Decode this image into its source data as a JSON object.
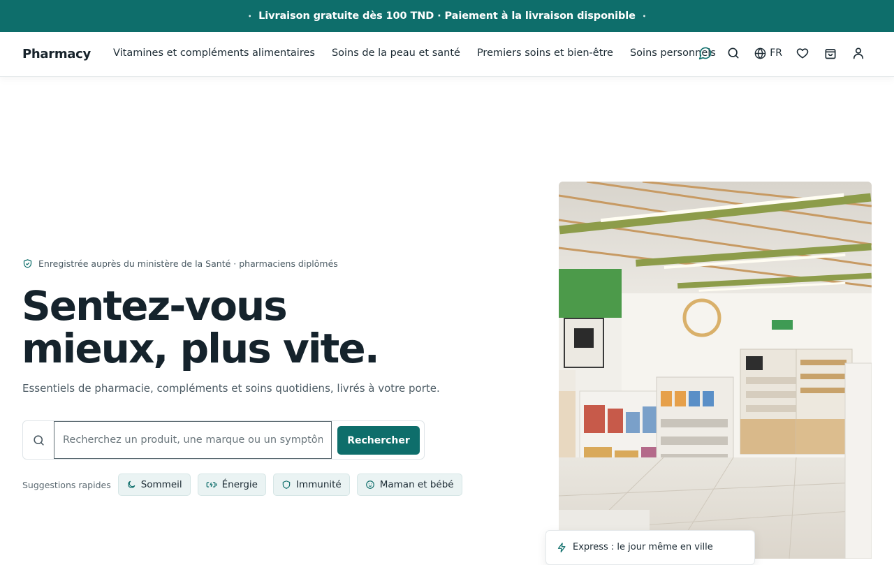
{
  "announcement": {
    "text": "Livraison gratuite dès 100 TND · Paiement à la livraison disponible",
    "bullet": "•"
  },
  "header": {
    "logo": "Pharmacy",
    "nav": [
      {
        "label": "Vitamines et compléments alimentaires"
      },
      {
        "label": "Soins de la peau et santé"
      },
      {
        "label": "Premiers soins et bien-être"
      },
      {
        "label": "Soins personnels"
      }
    ],
    "icons": [
      "chat-icon",
      "search-icon",
      "globe-icon",
      "heart-icon",
      "bag-icon",
      "user-icon"
    ],
    "language": "FR"
  },
  "hero": {
    "badge": "Enregistrée auprès du ministère de la Santé · pharmaciens diplômés",
    "title": "Sentez-vous mieux, plus vite.",
    "subtitle": "Essentiels de pharmacie, compléments et soins quotidiens, livrés à votre porte.",
    "search": {
      "placeholder": "Recherchez un produit, une marque ou un symptôme",
      "value": "",
      "button": "Rechercher"
    },
    "quick": {
      "label": "Suggestions rapides",
      "chips": [
        {
          "label": "Sommeil",
          "icon": "moon-icon"
        },
        {
          "label": "Énergie",
          "icon": "battery-icon"
        },
        {
          "label": "Immunité",
          "icon": "shield-icon"
        },
        {
          "label": "Maman et bébé",
          "icon": "baby-icon"
        }
      ]
    },
    "express": "Express : le jour même en ville"
  },
  "colors": {
    "brand": "#0e6e6b",
    "text": "#15232c",
    "chip_bg": "#eaf3f3"
  }
}
